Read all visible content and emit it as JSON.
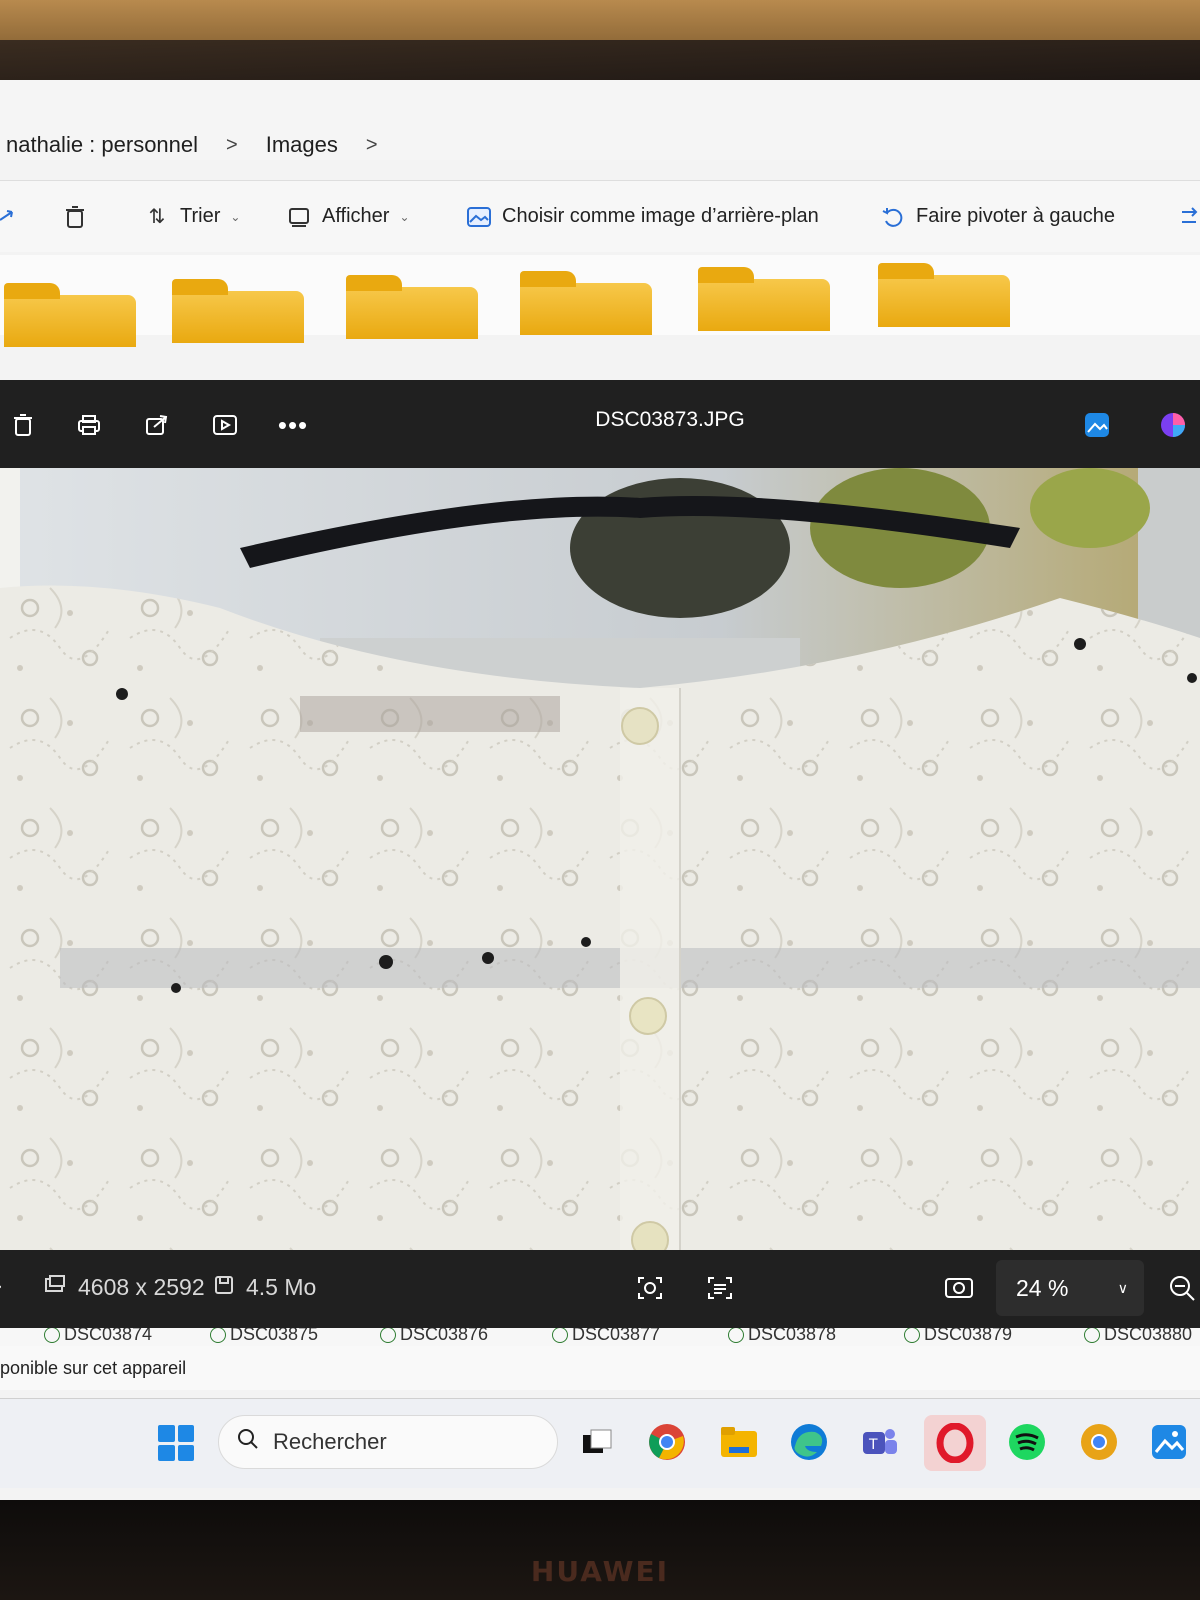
{
  "breadcrumb": {
    "items": [
      "nathalie : personnel",
      "Images"
    ],
    "separator": ">"
  },
  "explorer_toolbar": {
    "sort_label": "Trier",
    "view_label": "Afficher",
    "set_background_label": "Choisir comme image d’arrière-plan",
    "rotate_left_label": "Faire pivoter à gauche"
  },
  "viewer": {
    "file_name": "DSC03873.JPG",
    "dimensions": "4608 x 2592",
    "file_size": "4.5 Mo",
    "zoom": "24 %"
  },
  "filmstrip": {
    "items": [
      "DSC03874",
      "DSC03875",
      "DSC03876",
      "DSC03877",
      "DSC03878",
      "DSC03879",
      "DSC03880"
    ]
  },
  "explorer_status": {
    "text": "ponible sur cet appareil"
  },
  "taskbar": {
    "search_placeholder": "Rechercher"
  },
  "device": {
    "brand": "HUAWEI"
  },
  "colors": {
    "viewer_chrome": "#202020",
    "folder": "#f2b824",
    "accent_blue": "#1e88e5"
  }
}
